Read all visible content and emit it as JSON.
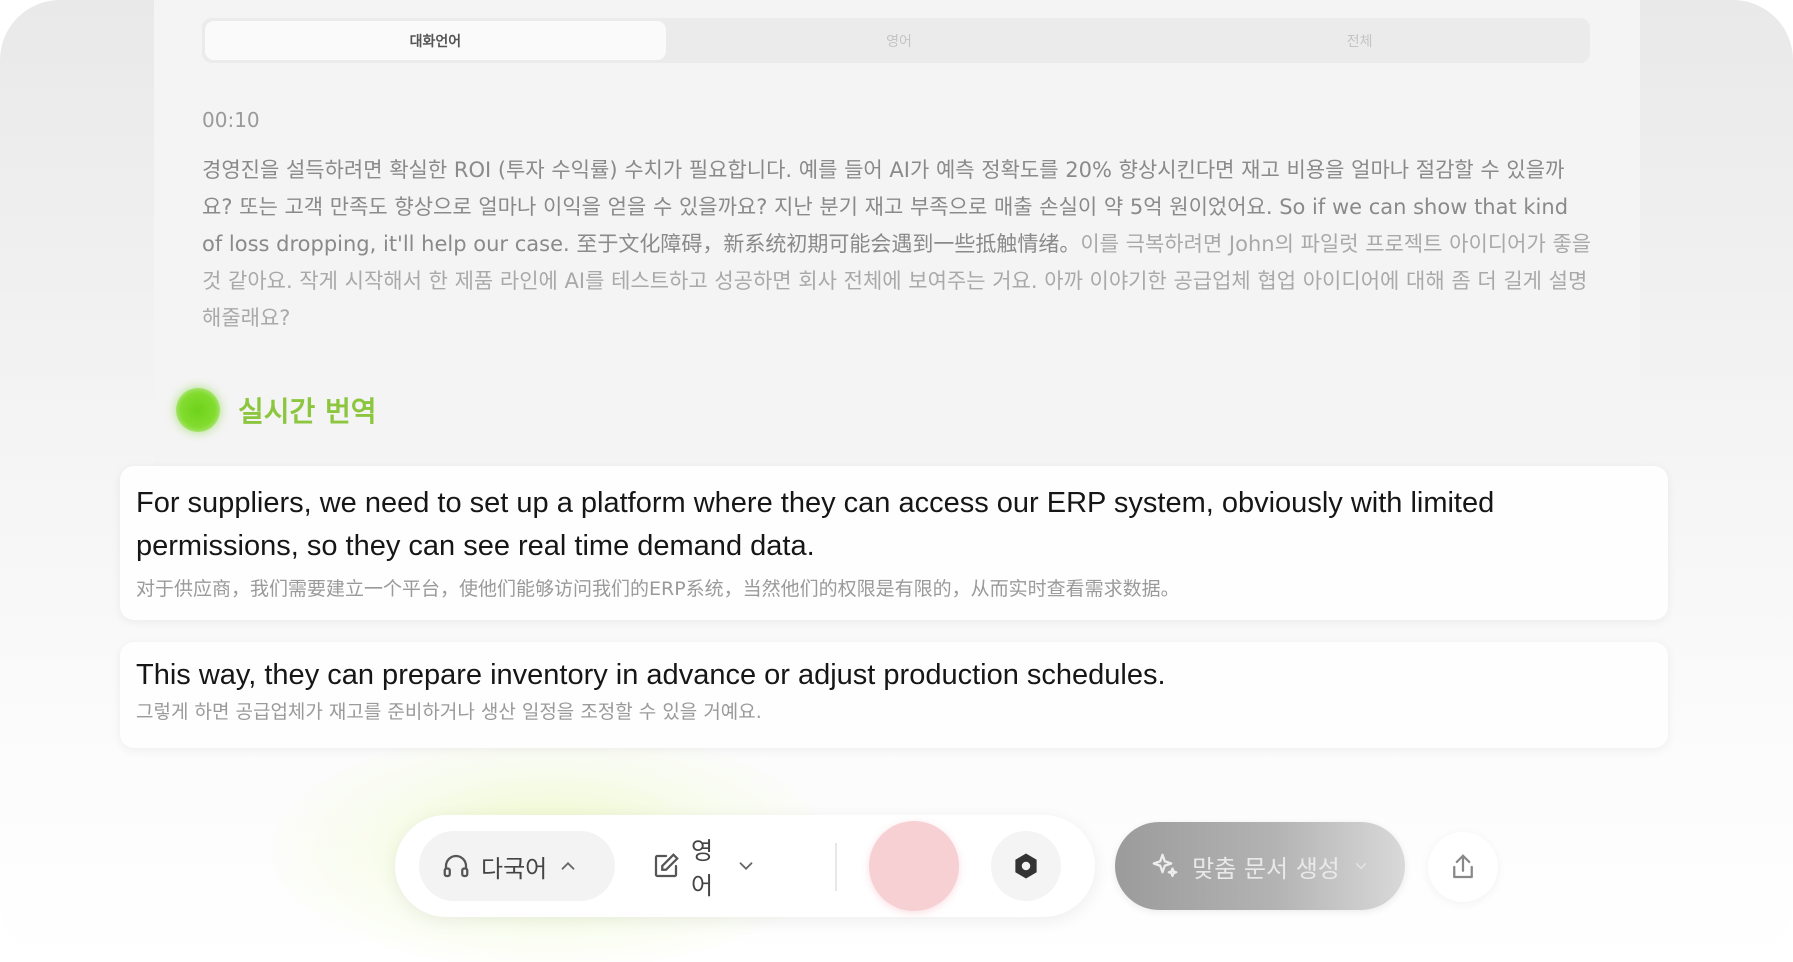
{
  "tabs": [
    {
      "label": "대화언어",
      "active": true
    },
    {
      "label": "영어",
      "active": false
    },
    {
      "label": "전체",
      "active": false
    }
  ],
  "transcript": {
    "timestamp": "00:10",
    "text_main": "경영진을 설득하려면 확실한 ROI (투자 수익률) 수치가 필요합니다. 예를 들어 AI가 예측 정확도를 20% 향상시킨다면 재고 비용을 얼마나 절감할 수 있을까요? 또는 고객 만족도 향상으로 얼마나 이익을 얻을 수 있을까요? 지난 분기 재고 부족으로 매출 손실이 약 5억 원이었어요. So if we can show that kind of loss dropping, it'll help our case. 至于文化障碍，新系统初期可能会遇到一些抵触情绪。",
    "text_fade": "이를 극복하려면 John의 파일럿 프로젝트 아이디어가 좋을 것 같아요. 작게 시작해서 한 제품 라인에 AI를 테스트하고 성공하면 회사 전체에 보여주는 거요. 아까 이야기한 공급업체 협업 아이디어에 대해 좀 더 길게 설명해줄래요?"
  },
  "live_translation": {
    "label": "실시간 번역",
    "accent": "#8cc63f"
  },
  "translations": [
    {
      "source": "For suppliers, we need to set up a platform where they can access our ERP system, obviously with limited permissions, so they can see real time demand data.",
      "translated": "对于供应商，我们需要建立一个平台，使他们能够访问我们的ERP系统，当然他们的权限是有限的，从而实时查看需求数据。"
    },
    {
      "source": "This way, they can prepare inventory in advance or adjust production schedules.",
      "translated": "그렇게 하면 공급업체가 재고를 준비하거나 생산 일정을 조정할 수 있을 거예요."
    }
  ],
  "toolbar": {
    "source_language": "다국어",
    "source_icon": "headphones-icon",
    "target_language": "영어",
    "target_icon": "edit-icon",
    "record_color": "#f7d0d3",
    "settings_icon": "gear-icon",
    "generate_label": "맞춤 문서 생성",
    "generate_icon": "sparkle-icon",
    "share_icon": "share-icon"
  }
}
